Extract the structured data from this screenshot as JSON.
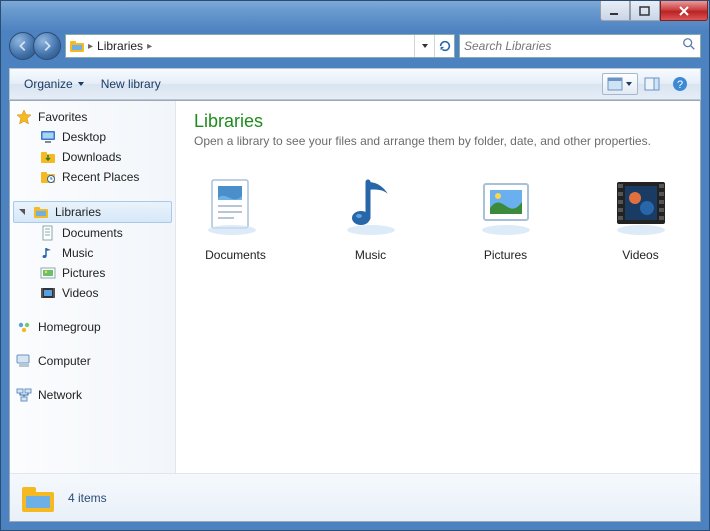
{
  "address": {
    "crumb": "Libraries"
  },
  "search": {
    "placeholder": "Search Libraries"
  },
  "toolbar": {
    "organize": "Organize",
    "newlib": "New library"
  },
  "nav": {
    "favorites": "Favorites",
    "desktop": "Desktop",
    "downloads": "Downloads",
    "recent": "Recent Places",
    "libraries": "Libraries",
    "documents": "Documents",
    "music": "Music",
    "pictures": "Pictures",
    "videos": "Videos",
    "homegroup": "Homegroup",
    "computer": "Computer",
    "network": "Network"
  },
  "content": {
    "title": "Libraries",
    "subtitle": "Open a library to see your files and arrange them by folder, date, and other properties.",
    "items": {
      "documents": "Documents",
      "music": "Music",
      "pictures": "Pictures",
      "videos": "Videos"
    }
  },
  "status": {
    "count": "4 items"
  }
}
